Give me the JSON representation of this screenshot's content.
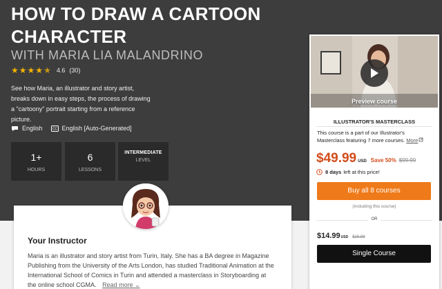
{
  "course": {
    "title": "HOW TO DRAW A CARTOON CHARACTER",
    "subtitle": "WITH MARIA LIA MALANDRINO",
    "rating": "4.6",
    "rating_count": "(30)",
    "description": "See how Maria, an illustrator and story artist, breaks down in easy steps, the process of drawing a \"cartoony\" portrait starting from a reference picture.",
    "audio_language": "English",
    "subtitles_language": "English [Auto-Generated]"
  },
  "stats": [
    {
      "value": "1+",
      "label": "HOURS"
    },
    {
      "value": "6",
      "label": "LESSONS"
    },
    {
      "value": "INTERMEDIATE",
      "label": "LEVEL"
    }
  ],
  "instructor": {
    "heading": "Your Instructor",
    "bio": "Maria is an illustrator and story artist from Turin, Italy. She has a BA degree in Magazine Publishing from the University of the Arts London, has studied Traditional Animation at the International School of Comics in Turin and attended a masterclass in Storyboarding at the online school CGMA.",
    "read_more": "Read more"
  },
  "purchase": {
    "video_label": "Preview course",
    "masterclass_label": "ILLUSTRATOR'S MASTERCLASS",
    "description": "This course is a part of our Illustrator's Masterclass featuring 7 more courses.",
    "more_link": "More",
    "price": "$49.99",
    "currency": "USD",
    "save": "Save 50%",
    "old_price": "$99.99",
    "timer_bold": "8 days",
    "timer_rest": "left at this price!",
    "buy_all_label": "Buy all 8 courses",
    "including": "(including this course)",
    "or": "OR",
    "single_price": "$14.99",
    "single_currency": "USD",
    "single_old_price": "$29.99",
    "single_label": "Single Course"
  },
  "icons": {
    "star": "star-icon",
    "audio": "speech-bubble-icon",
    "subtitles": "cc-icon",
    "clock": "clock-icon",
    "external": "external-link-icon",
    "play": "play-icon",
    "chevron": "chevron-down-icon"
  },
  "colors": {
    "hero_background": "#3d3d3d",
    "accent_orange": "#ef7a1a",
    "price_red": "#d24c1b",
    "star_gold": "#f5b301"
  }
}
